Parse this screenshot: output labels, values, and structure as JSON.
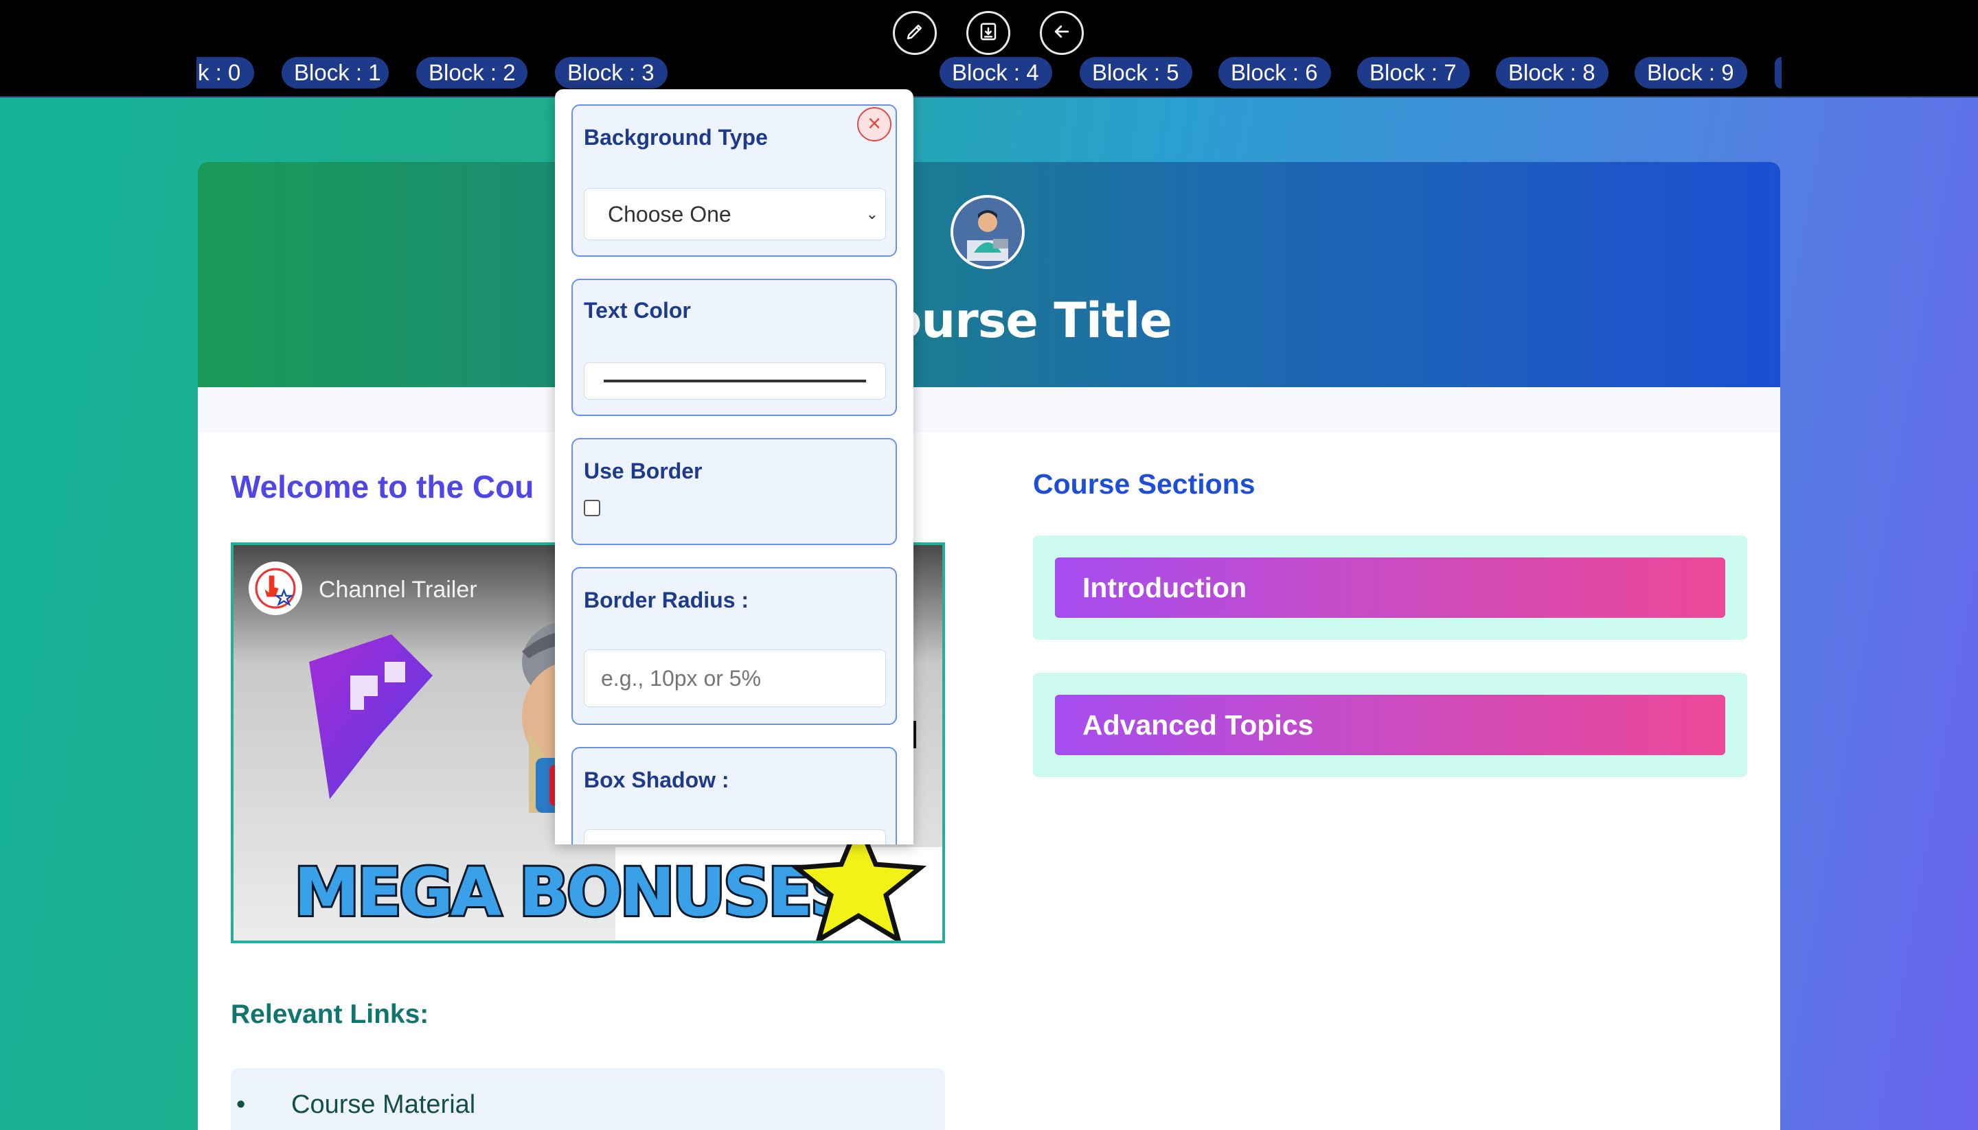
{
  "toolbar": {
    "buttons": [
      {
        "name": "edit",
        "icon": "pencil-icon"
      },
      {
        "name": "save",
        "icon": "save-icon"
      },
      {
        "name": "back",
        "icon": "arrow-left-icon"
      }
    ],
    "block_tabs": [
      "k : 0",
      "Block : 1",
      "Block : 2",
      "Block : 3",
      "Block : 4",
      "Block : 5",
      "Block : 6",
      "Block : 7",
      "Block : 8",
      "Block : 9"
    ]
  },
  "hero": {
    "avatar_icon": "course-avatar-icon",
    "title_visible": "e Course Title"
  },
  "main": {
    "welcome_visible": "Welcome to the Cou",
    "video": {
      "channel_title": "Channel Trailer",
      "overlay_text": "MEGA BONUSES"
    },
    "links_heading": "Relevant Links:",
    "links": [
      "Course Material"
    ]
  },
  "sections": {
    "heading": "Course Sections",
    "items": [
      "Introduction",
      "Advanced Topics"
    ]
  },
  "popup": {
    "close_icon": "close-icon",
    "background_type": {
      "label": "Background Type",
      "selected": "Choose One"
    },
    "text_color": {
      "label": "Text Color"
    },
    "use_border": {
      "label": "Use Border",
      "checked": false
    },
    "border_radius": {
      "label": "Border Radius :",
      "placeholder": "e.g., 10px or 5%"
    },
    "box_shadow": {
      "label": "Box Shadow :"
    }
  },
  "colors": {
    "toolbar_bg": "#000000",
    "block_tab_bg": "#1e3a8a",
    "accent_indigo": "#4f46e5",
    "section_bg": "#ccfaef",
    "section_btn_start": "#a64df0",
    "section_btn_end": "#ec4897",
    "popup_field_border": "#6a8fe6"
  }
}
